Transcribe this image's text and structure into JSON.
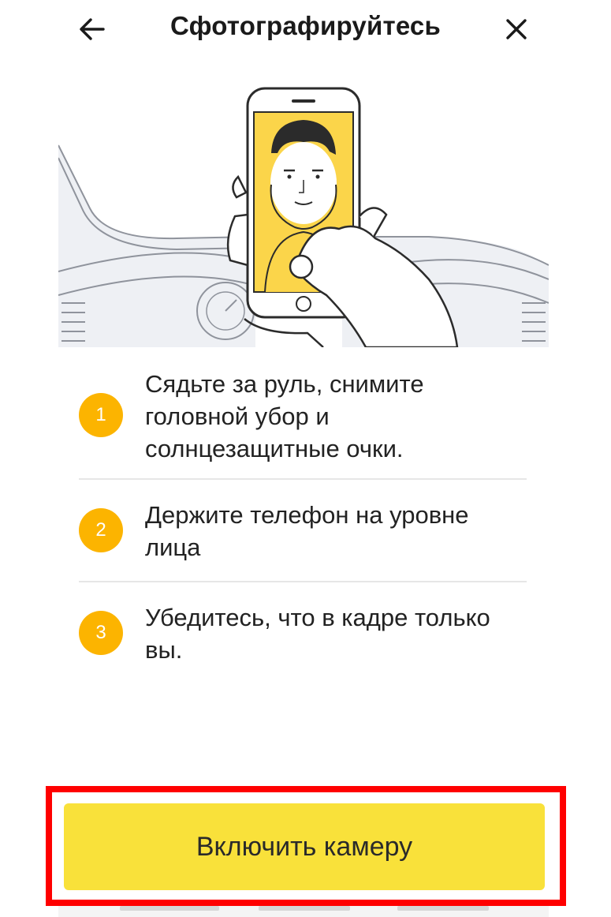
{
  "header": {
    "title": "Сфотографируйтесь",
    "back_icon": "arrow-left-icon",
    "close_icon": "close-icon"
  },
  "illustration": {
    "icon": "driver-selfie-illustration"
  },
  "steps": [
    {
      "number": "1",
      "text": "Сядьте за руль, снимите головной убор и солнцезащитные очки."
    },
    {
      "number": "2",
      "text": "Держите телефон на уровне лица"
    },
    {
      "number": "3",
      "text": "Убедитесь, что в кадре только вы."
    }
  ],
  "button": {
    "label": "Включить камеру"
  },
  "colors": {
    "accent_yellow": "#f9e13a",
    "badge_orange": "#fcb400",
    "highlight_red": "#ff0000"
  }
}
